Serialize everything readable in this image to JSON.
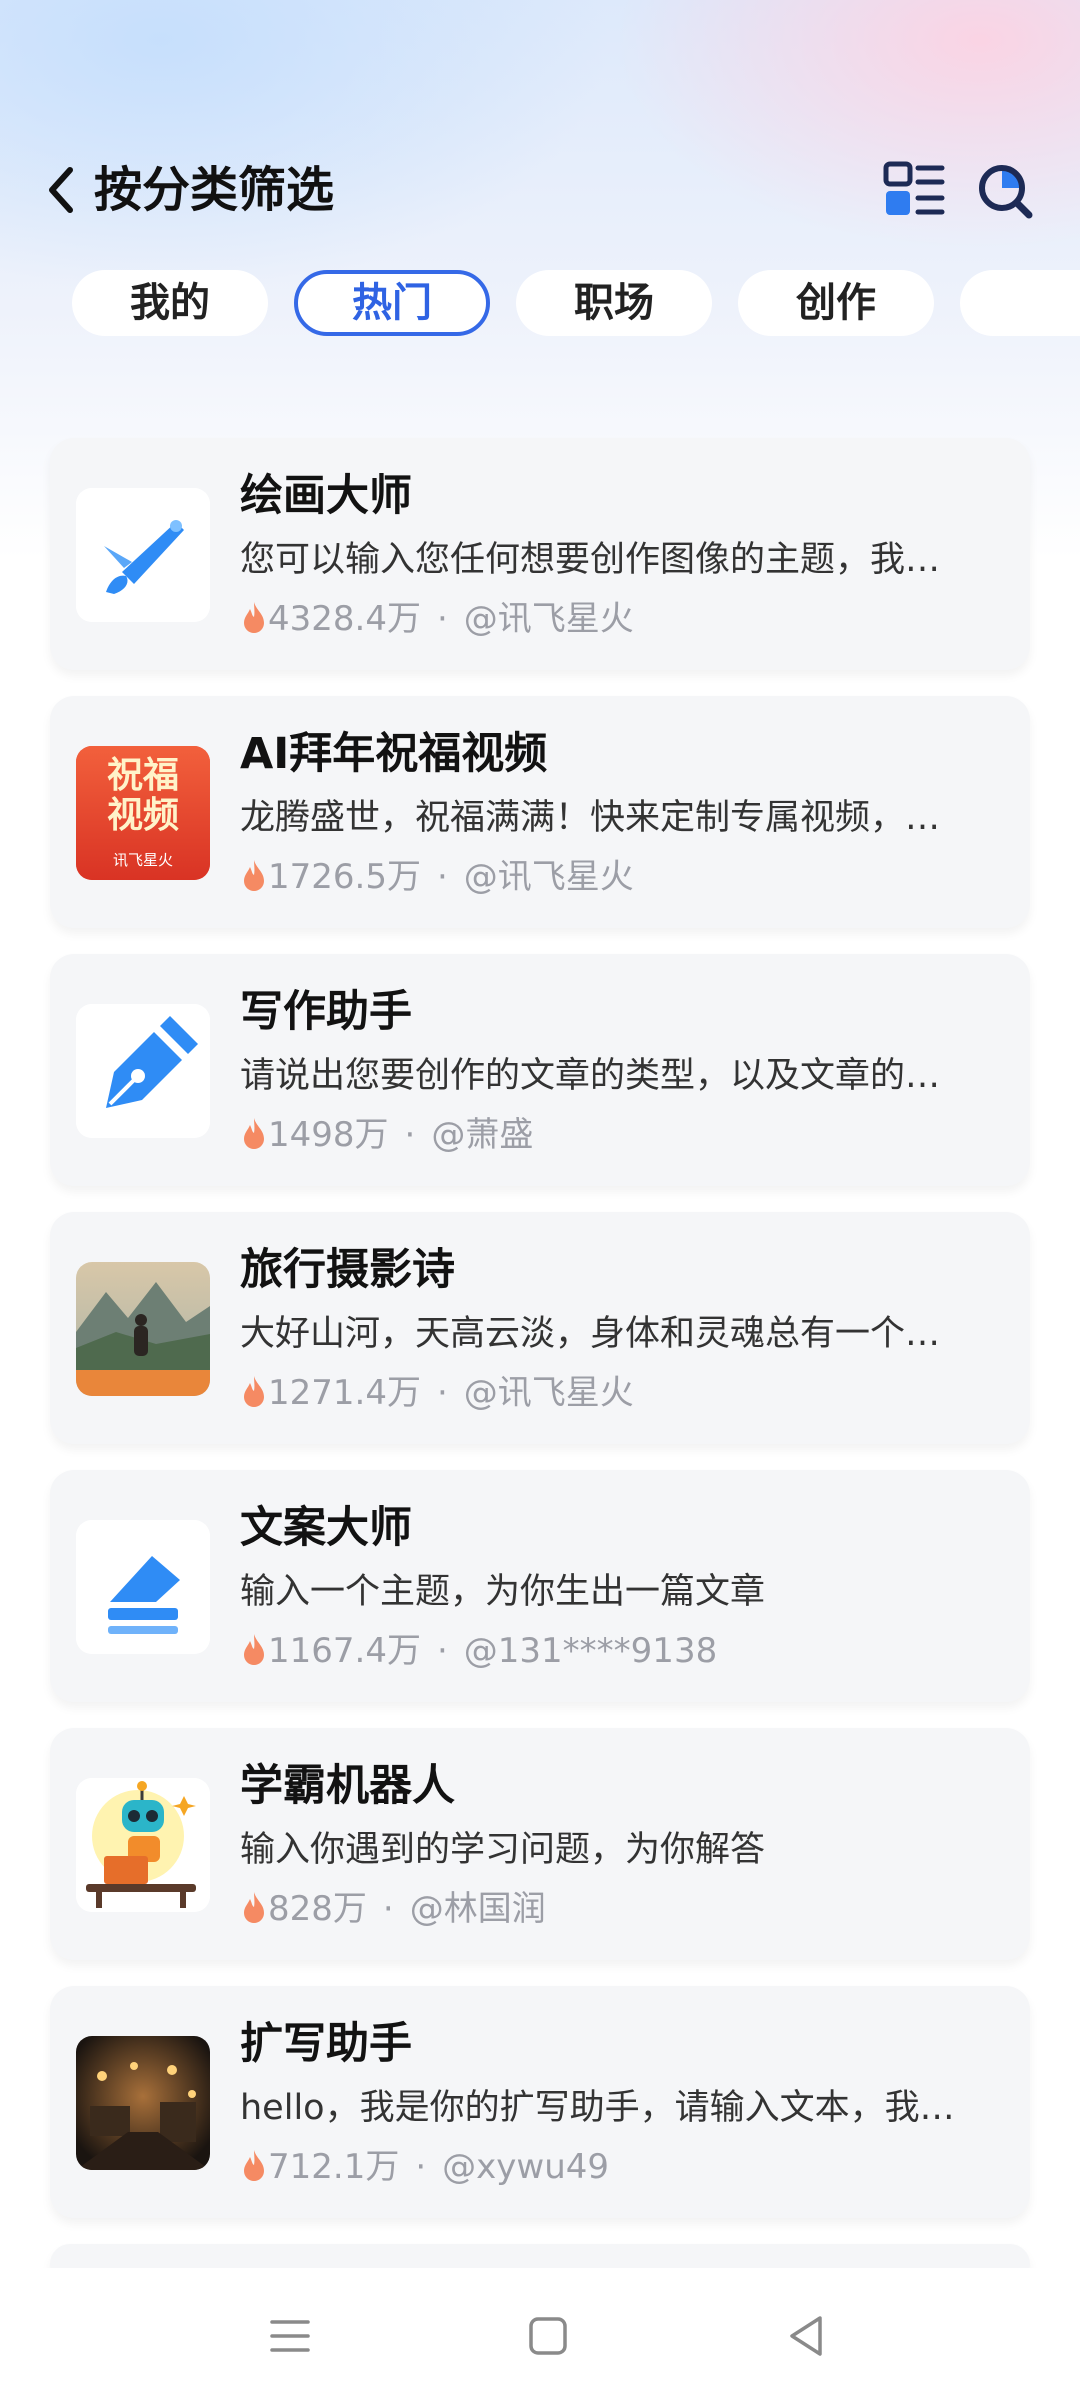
{
  "header": {
    "title": "按分类筛选"
  },
  "tabs": [
    {
      "label": "我的",
      "active": false
    },
    {
      "label": "热门",
      "active": true
    },
    {
      "label": "职场",
      "active": false
    },
    {
      "label": "创作",
      "active": false
    }
  ],
  "items": [
    {
      "title": "绘画大师",
      "desc": "您可以输入您任何想要创作图像的主题，我…",
      "heat": "4328.4万",
      "author": "@讯飞星火",
      "icon": "paint-brush-icon"
    },
    {
      "title": "AI拜年祝福视频",
      "desc": "龙腾盛世，祝福满满！快来定制专属视频，…",
      "heat": "1726.5万",
      "author": "@讯飞星火",
      "icon": "blessing-video-icon",
      "thumb_text": [
        "祝福",
        "视频"
      ],
      "thumb_brand": "讯飞星火"
    },
    {
      "title": "写作助手",
      "desc": "请说出您要创作的文章的类型，以及文章的…",
      "heat": "1498万",
      "author": "@萧盛",
      "icon": "pen-nib-icon"
    },
    {
      "title": "旅行摄影诗",
      "desc": "大好山河，天高云淡，身体和灵魂总有一个…",
      "heat": "1271.4万",
      "author": "@讯飞星火",
      "icon": "travel-photo-icon"
    },
    {
      "title": "文案大师",
      "desc": "输入一个主题，为你生出一篇文章",
      "heat": "1167.4万",
      "author": "@131****9138",
      "icon": "eraser-icon"
    },
    {
      "title": "学霸机器人",
      "desc": "输入你遇到的学习问题，为你解答",
      "heat": "828万",
      "author": "@林国润",
      "icon": "robot-icon"
    },
    {
      "title": "扩写助手",
      "desc": "hello，我是你的扩写助手，请输入文本，我…",
      "heat": "712.1万",
      "author": "@xywu49",
      "icon": "night-scene-icon"
    }
  ],
  "meta_separator": "·",
  "colors": {
    "accent": "#3569e7",
    "flame": "#f27a50",
    "card_bg": "#f5f6f8",
    "icon_blue": "#2f8cf5"
  }
}
